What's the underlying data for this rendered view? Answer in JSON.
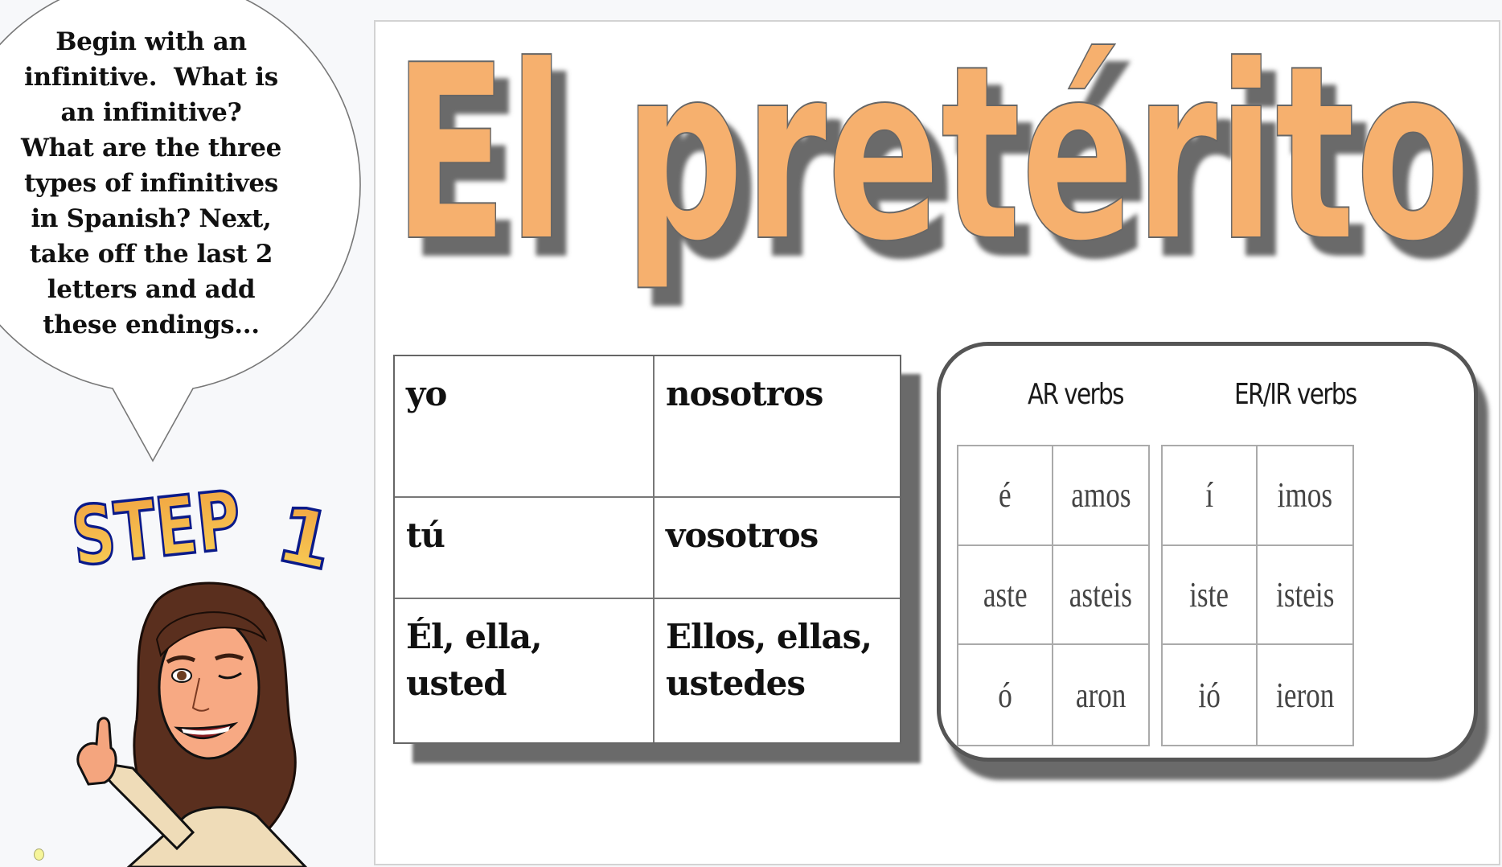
{
  "speech_bubble": {
    "lines": [
      "Begin with an",
      "infinitive.  What is",
      "an infinitive?",
      "What are the three",
      "types of infinitives",
      "in Spanish? Next,",
      "take off the last 2",
      "letters and add",
      "these endings..."
    ]
  },
  "step_label": {
    "word": "STEP",
    "number": "1"
  },
  "slide": {
    "title": "El pretérito",
    "colors": {
      "title_fill": "#f6b06e",
      "title_outline": "#666666",
      "shadow": "#6a6a6a",
      "step_top": "#f0a040",
      "step_bottom": "#f8d258",
      "step_outline": "#0a1a8a"
    },
    "pronoun_table": {
      "rows": [
        [
          "yo",
          "nosotros"
        ],
        [
          "tú",
          "vosotros"
        ],
        [
          "Él, ella,\nusted",
          "Ellos, ellas,\nustedes"
        ]
      ]
    },
    "endings": {
      "ar": {
        "heading": "AR verbs",
        "rows": [
          [
            "é",
            "amos"
          ],
          [
            "aste",
            "asteis"
          ],
          [
            "ó",
            "aron"
          ]
        ]
      },
      "er_ir": {
        "heading": "ER/IR verbs",
        "rows": [
          [
            "í",
            "imos"
          ],
          [
            "iste",
            "isteis"
          ],
          [
            "ió",
            "ieron"
          ]
        ]
      }
    }
  }
}
